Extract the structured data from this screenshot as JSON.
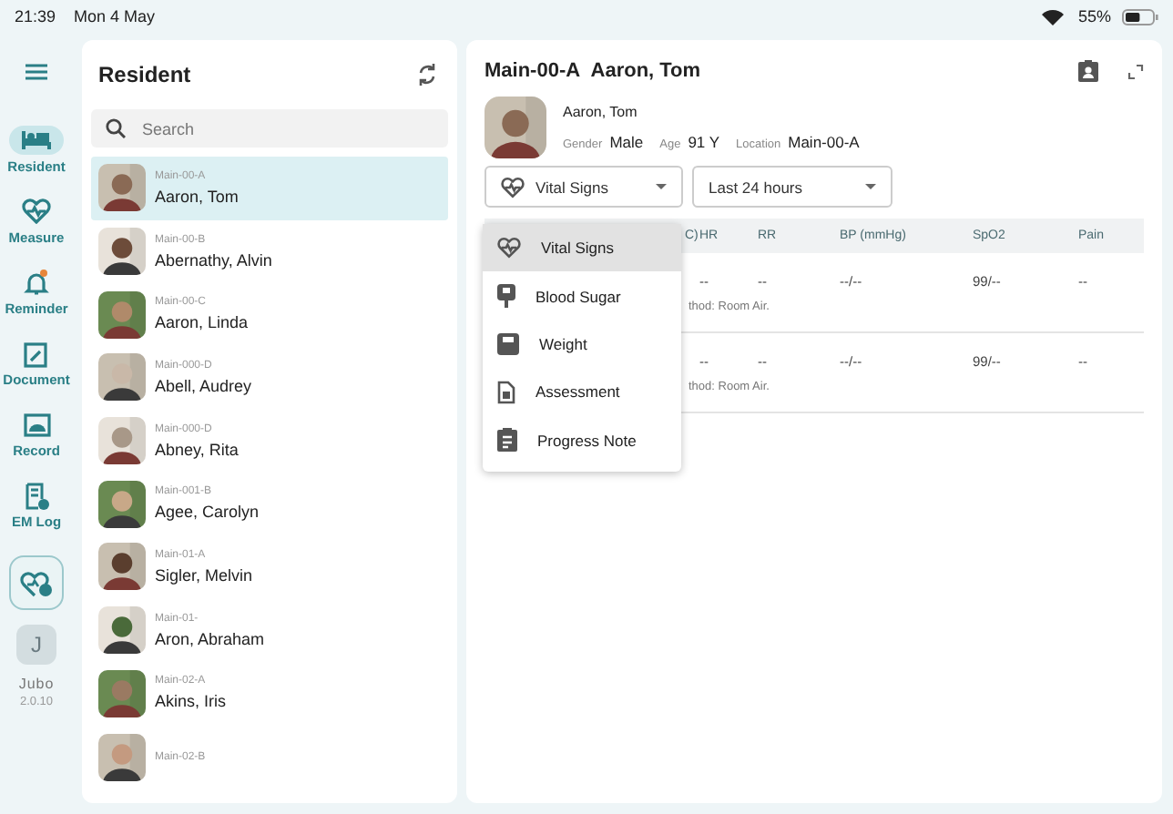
{
  "status_bar": {
    "time": "21:39",
    "date": "Mon 4 May",
    "battery": "55%"
  },
  "nav": [
    {
      "label": "Resident",
      "kind": "bed",
      "selected": true,
      "badge": false
    },
    {
      "label": "Measure",
      "kind": "heart",
      "selected": false,
      "badge": false
    },
    {
      "label": "Reminder",
      "kind": "bell",
      "selected": false,
      "badge": true
    },
    {
      "label": "Document",
      "kind": "doc",
      "selected": false,
      "badge": false
    },
    {
      "label": "Record",
      "kind": "record",
      "selected": false,
      "badge": false
    },
    {
      "label": "EM Log",
      "kind": "log",
      "selected": false,
      "badge": false
    }
  ],
  "user_initial": "J",
  "brand": "Jubo",
  "version": "2.0.10",
  "resident_panel": {
    "title": "Resident",
    "search": {
      "placeholder": "Search"
    },
    "residents": [
      {
        "room": "Main-00-A",
        "name": "Aaron, Tom",
        "selected": true
      },
      {
        "room": "Main-00-B",
        "name": "Abernathy, Alvin",
        "selected": false
      },
      {
        "room": "Main-00-C",
        "name": "Aaron, Linda",
        "selected": false
      },
      {
        "room": "Main-000-D",
        "name": "Abell, Audrey",
        "selected": false
      },
      {
        "room": "Main-000-D",
        "name": "Abney, Rita",
        "selected": false
      },
      {
        "room": "Main-001-B",
        "name": "Agee, Carolyn",
        "selected": false
      },
      {
        "room": "Main-01-A",
        "name": "Sigler, Melvin",
        "selected": false
      },
      {
        "room": "Main-01-",
        "name": "Aron, Abraham",
        "selected": false
      },
      {
        "room": "Main-02-A",
        "name": "Akins, Iris",
        "selected": false
      },
      {
        "room": "Main-02-B",
        "selected": false
      }
    ]
  },
  "detail": {
    "title_room": "Main-00-A",
    "title_name": "Aaron, Tom",
    "name": "Aaron, Tom",
    "fields": [
      {
        "label": "Gender",
        "value": "Male"
      },
      {
        "label": "Age",
        "value": "91 Y"
      },
      {
        "label": "Location",
        "value": "Main-00-A"
      }
    ],
    "category_select": "Vital Signs",
    "range_select": "Last 24 hours",
    "table": {
      "columns": [
        "C)",
        "HR",
        "RR",
        "BP (mmHg)",
        "SpO2",
        "Pain"
      ],
      "rows": [
        {
          "cells": [
            "",
            "--",
            "--",
            "--/--",
            "99/--",
            "--"
          ],
          "note": "thod: Room Air."
        },
        {
          "cells": [
            "",
            "--",
            "--",
            "--/--",
            "99/--",
            "--"
          ],
          "note": "thod: Room Air."
        }
      ]
    },
    "menu": [
      {
        "label": "Vital Signs",
        "kind": "heart",
        "selected": true
      },
      {
        "label": "Blood Sugar",
        "kind": "drop",
        "selected": false
      },
      {
        "label": "Weight",
        "kind": "scale",
        "selected": false
      },
      {
        "label": "Assessment",
        "kind": "doc",
        "selected": false
      },
      {
        "label": "Progress Note",
        "kind": "clip",
        "selected": false
      }
    ]
  }
}
